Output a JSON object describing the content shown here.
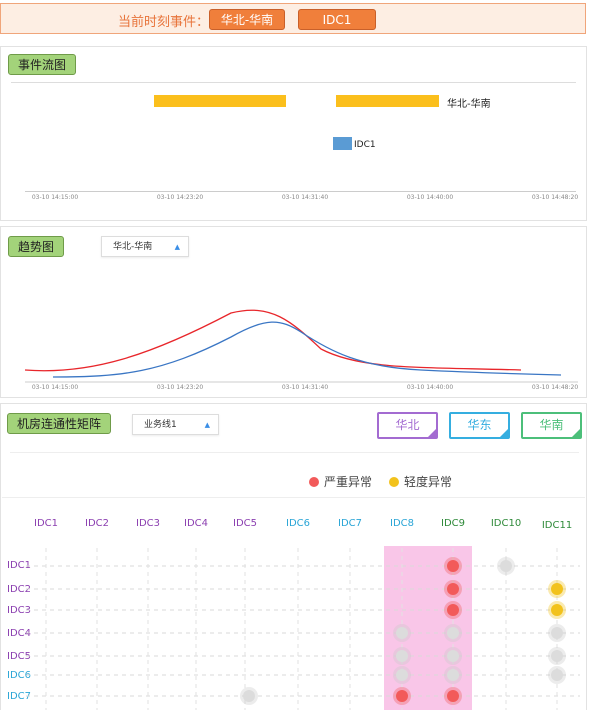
{
  "topbar": {
    "label": "当前时刻事件：",
    "chips": [
      "华北-华南",
      "IDC1"
    ]
  },
  "event_flow": {
    "title": "事件流图",
    "bars": [
      {
        "label": "华北-华南",
        "color": "#fbbf1c"
      },
      {
        "label": "IDC1",
        "color": "#5a9bd4"
      }
    ],
    "ticks": [
      "03-10 14:15:00",
      "03-10 14:23:20",
      "03-10 14:31:40",
      "03-10 14:40:00",
      "03-10 14:48:20"
    ]
  },
  "trend": {
    "title": "趋势图",
    "select_value": "华北-华南",
    "ticks": [
      "03-10 14:15:00",
      "03-10 14:23:20",
      "03-10 14:31:40",
      "03-10 14:40:00",
      "03-10 14:48:20"
    ],
    "series_colors": [
      "#e8262b",
      "#3a76c4"
    ]
  },
  "matrix": {
    "title": "机房连通性矩阵",
    "select_value": "业务线1",
    "regions": [
      {
        "label": "华北",
        "color": "#a36bd1"
      },
      {
        "label": "华东",
        "color": "#35aee0"
      },
      {
        "label": "华南",
        "color": "#4cbf7a"
      }
    ],
    "legend": [
      {
        "label": "严重异常",
        "color": "#f25a5a"
      },
      {
        "label": "轻度异常",
        "color": "#f2c21c"
      }
    ],
    "columns": [
      {
        "label": "IDC1",
        "color": "#8b3fb0"
      },
      {
        "label": "IDC2",
        "color": "#8b3fb0"
      },
      {
        "label": "IDC3",
        "color": "#8b3fb0"
      },
      {
        "label": "IDC4",
        "color": "#8b3fb0"
      },
      {
        "label": "IDC5",
        "color": "#8b3fb0"
      },
      {
        "label": "IDC6",
        "color": "#2aa5d6"
      },
      {
        "label": "IDC7",
        "color": "#2aa5d6"
      },
      {
        "label": "IDC8",
        "color": "#2aa5d6"
      },
      {
        "label": "IDC9",
        "color": "#2f8a3a"
      },
      {
        "label": "IDC10",
        "color": "#2f8a3a"
      },
      {
        "label": "IDC11",
        "color": "#2f8a3a"
      }
    ],
    "rows": [
      {
        "label": "IDC1",
        "color": "#8b3fb0"
      },
      {
        "label": "IDC2",
        "color": "#8b3fb0"
      },
      {
        "label": "IDC3",
        "color": "#8b3fb0"
      },
      {
        "label": "IDC4",
        "color": "#8b3fb0"
      },
      {
        "label": "IDC5",
        "color": "#8b3fb0"
      },
      {
        "label": "IDC6",
        "color": "#2aa5d6"
      },
      {
        "label": "IDC7",
        "color": "#2aa5d6"
      }
    ],
    "cells": [
      {
        "row": 0,
        "col": 8,
        "status": "severe"
      },
      {
        "row": 0,
        "col": 9,
        "status": "normal"
      },
      {
        "row": 1,
        "col": 8,
        "status": "severe"
      },
      {
        "row": 1,
        "col": 10,
        "status": "minor"
      },
      {
        "row": 2,
        "col": 8,
        "status": "severe"
      },
      {
        "row": 2,
        "col": 10,
        "status": "minor"
      },
      {
        "row": 3,
        "col": 7,
        "status": "normal"
      },
      {
        "row": 3,
        "col": 8,
        "status": "normal"
      },
      {
        "row": 3,
        "col": 10,
        "status": "normal"
      },
      {
        "row": 4,
        "col": 7,
        "status": "normal"
      },
      {
        "row": 4,
        "col": 8,
        "status": "normal"
      },
      {
        "row": 4,
        "col": 10,
        "status": "normal"
      },
      {
        "row": 5,
        "col": 7,
        "status": "normal"
      },
      {
        "row": 5,
        "col": 8,
        "status": "normal"
      },
      {
        "row": 5,
        "col": 10,
        "status": "normal"
      },
      {
        "row": 6,
        "col": 4,
        "status": "normal"
      },
      {
        "row": 6,
        "col": 7,
        "status": "severe"
      },
      {
        "row": 6,
        "col": 8,
        "status": "severe"
      }
    ],
    "highlight_color": "#f9c6e8"
  }
}
